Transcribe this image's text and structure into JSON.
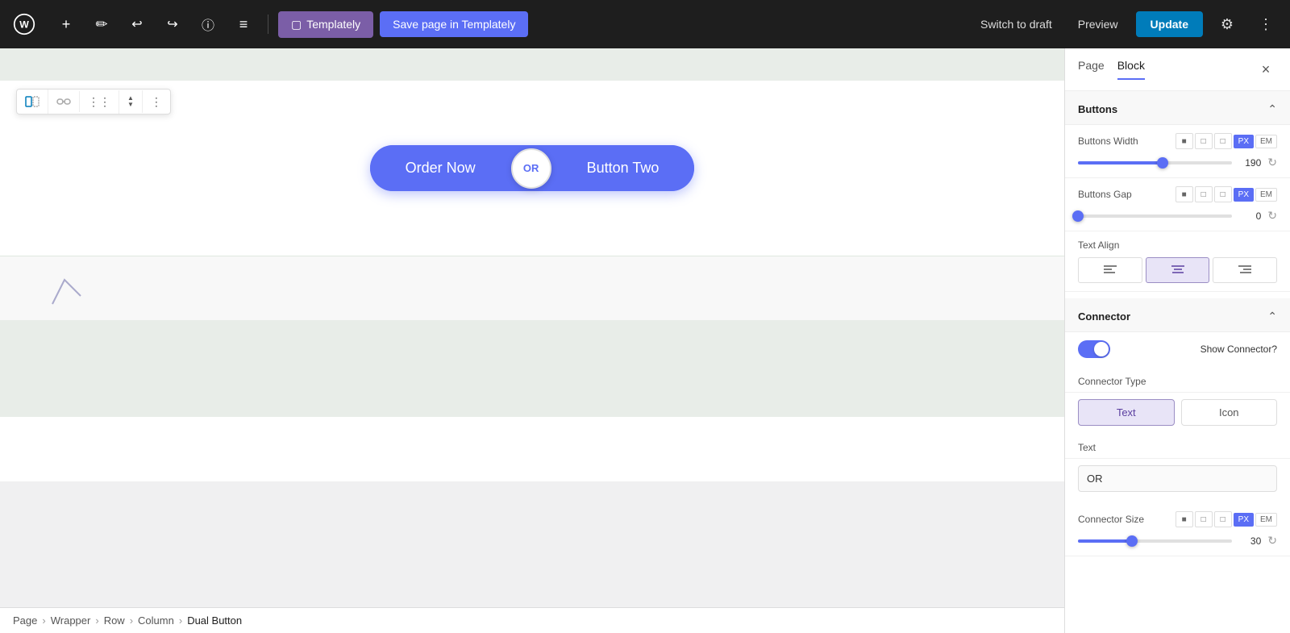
{
  "toolbar": {
    "wp_logo_title": "WordPress",
    "add_btn": "+",
    "pencil_btn": "✏",
    "undo_btn": "↩",
    "redo_btn": "↪",
    "info_btn": "ℹ",
    "list_btn": "≡",
    "templately_btn": "Templately",
    "save_templately_btn": "Save page in Templately",
    "switch_draft_btn": "Switch to draft",
    "preview_btn": "Preview",
    "update_btn": "Update",
    "settings_btn": "⚙",
    "more_btn": "⋮"
  },
  "canvas": {
    "dual_button": {
      "btn1_label": "Order Now",
      "connector_label": "OR",
      "btn2_label": "Button Two"
    }
  },
  "breadcrumb": {
    "items": [
      "Page",
      "Wrapper",
      "Row",
      "Column",
      "Dual Button"
    ],
    "separators": [
      "›",
      "›",
      "›",
      "›"
    ]
  },
  "panel": {
    "tab_page": "Page",
    "tab_block": "Block",
    "close_btn": "×",
    "sections": {
      "buttons": {
        "title": "Buttons",
        "buttons_width": {
          "label": "Buttons Width",
          "value": "190",
          "slider_pct": 55,
          "unit_px": "PX",
          "unit_em": "EM"
        },
        "buttons_gap": {
          "label": "Buttons Gap",
          "value": "0",
          "slider_pct": 0,
          "unit_px": "PX",
          "unit_em": "EM"
        },
        "text_align": {
          "label": "Text Align",
          "options": [
            "align-left",
            "align-center",
            "align-right"
          ],
          "active": "align-center"
        }
      },
      "connector": {
        "title": "Connector",
        "show_connector_label": "Show Connector?",
        "show_connector_value": true,
        "connector_type_label": "Connector Type",
        "connector_type_text": "Text",
        "connector_type_icon": "Icon",
        "connector_type_active": "Text",
        "text_label": "Text",
        "text_value": "OR",
        "connector_size": {
          "label": "Connector Size",
          "value": "30",
          "slider_pct": 35,
          "unit_px": "PX",
          "unit_em": "EM"
        }
      }
    }
  }
}
